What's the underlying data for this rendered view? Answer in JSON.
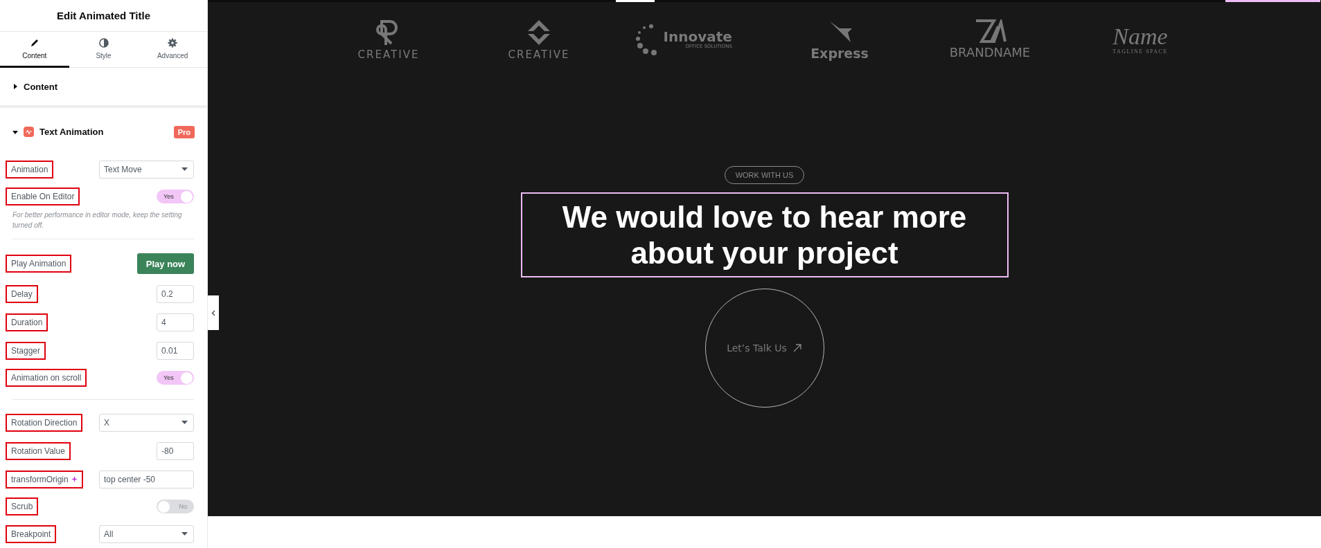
{
  "panel": {
    "title": "Edit Animated Title",
    "tabs": [
      {
        "label": "Content",
        "selected": true
      },
      {
        "label": "Style",
        "selected": false
      },
      {
        "label": "Advanced",
        "selected": false
      }
    ],
    "sections": [
      {
        "title": "Content",
        "expanded": false
      },
      {
        "title": "Text Animation",
        "expanded": true,
        "badge": "Pro",
        "rows": [
          {
            "kind": "select",
            "label": "Animation",
            "value": "Text Move",
            "highlighted": true
          },
          {
            "kind": "switch",
            "label": "Enable On Editor",
            "on": true,
            "state_text": "Yes",
            "hint": "For better performance in editor mode, keep the setting turned off.",
            "highlighted": true
          },
          {
            "kind": "divider"
          },
          {
            "kind": "button",
            "label": "Play Animation",
            "button": "Play now",
            "highlighted": true
          },
          {
            "kind": "number",
            "label": "Delay",
            "value": "0.2",
            "highlighted": true
          },
          {
            "kind": "number",
            "label": "Duration",
            "value": "4",
            "highlighted": true
          },
          {
            "kind": "number",
            "label": "Stagger",
            "value": "0.01",
            "highlighted": true
          },
          {
            "kind": "switch",
            "label": "Animation on scroll",
            "on": true,
            "state_text": "Yes",
            "highlighted": true
          },
          {
            "kind": "divider"
          },
          {
            "kind": "select",
            "label": "Rotation Direction",
            "value": "X",
            "highlighted": true
          },
          {
            "kind": "number",
            "label": "Rotation Value",
            "value": "-80",
            "highlighted": true
          },
          {
            "kind": "text",
            "label": "transformOrigin",
            "value": "top center -50",
            "ai": true,
            "highlighted": true
          },
          {
            "kind": "switch",
            "label": "Scrub",
            "on": false,
            "state_text": "No",
            "highlighted": true
          },
          {
            "kind": "select",
            "label": "Breakpoint",
            "value": "All",
            "highlighted": true
          }
        ]
      }
    ]
  },
  "canvas": {
    "logos": [
      {
        "kind": "r-mark",
        "text": "CREATIVE"
      },
      {
        "kind": "diamond",
        "text": "CREATIVE"
      },
      {
        "kind": "dots",
        "text": "Innovate",
        "sub": "OFFICE SOLUTIONS"
      },
      {
        "kind": "x-mark",
        "text": "Express"
      },
      {
        "kind": "za-mark",
        "text": "BRANDNAME"
      },
      {
        "kind": "script",
        "text": "Name",
        "sub": "TAGLINE SPACE"
      }
    ],
    "tag": "WORK WITH US",
    "heading": "We would love to hear more about your project",
    "heading_selected": true,
    "cta": "Let’s Talk Us"
  }
}
